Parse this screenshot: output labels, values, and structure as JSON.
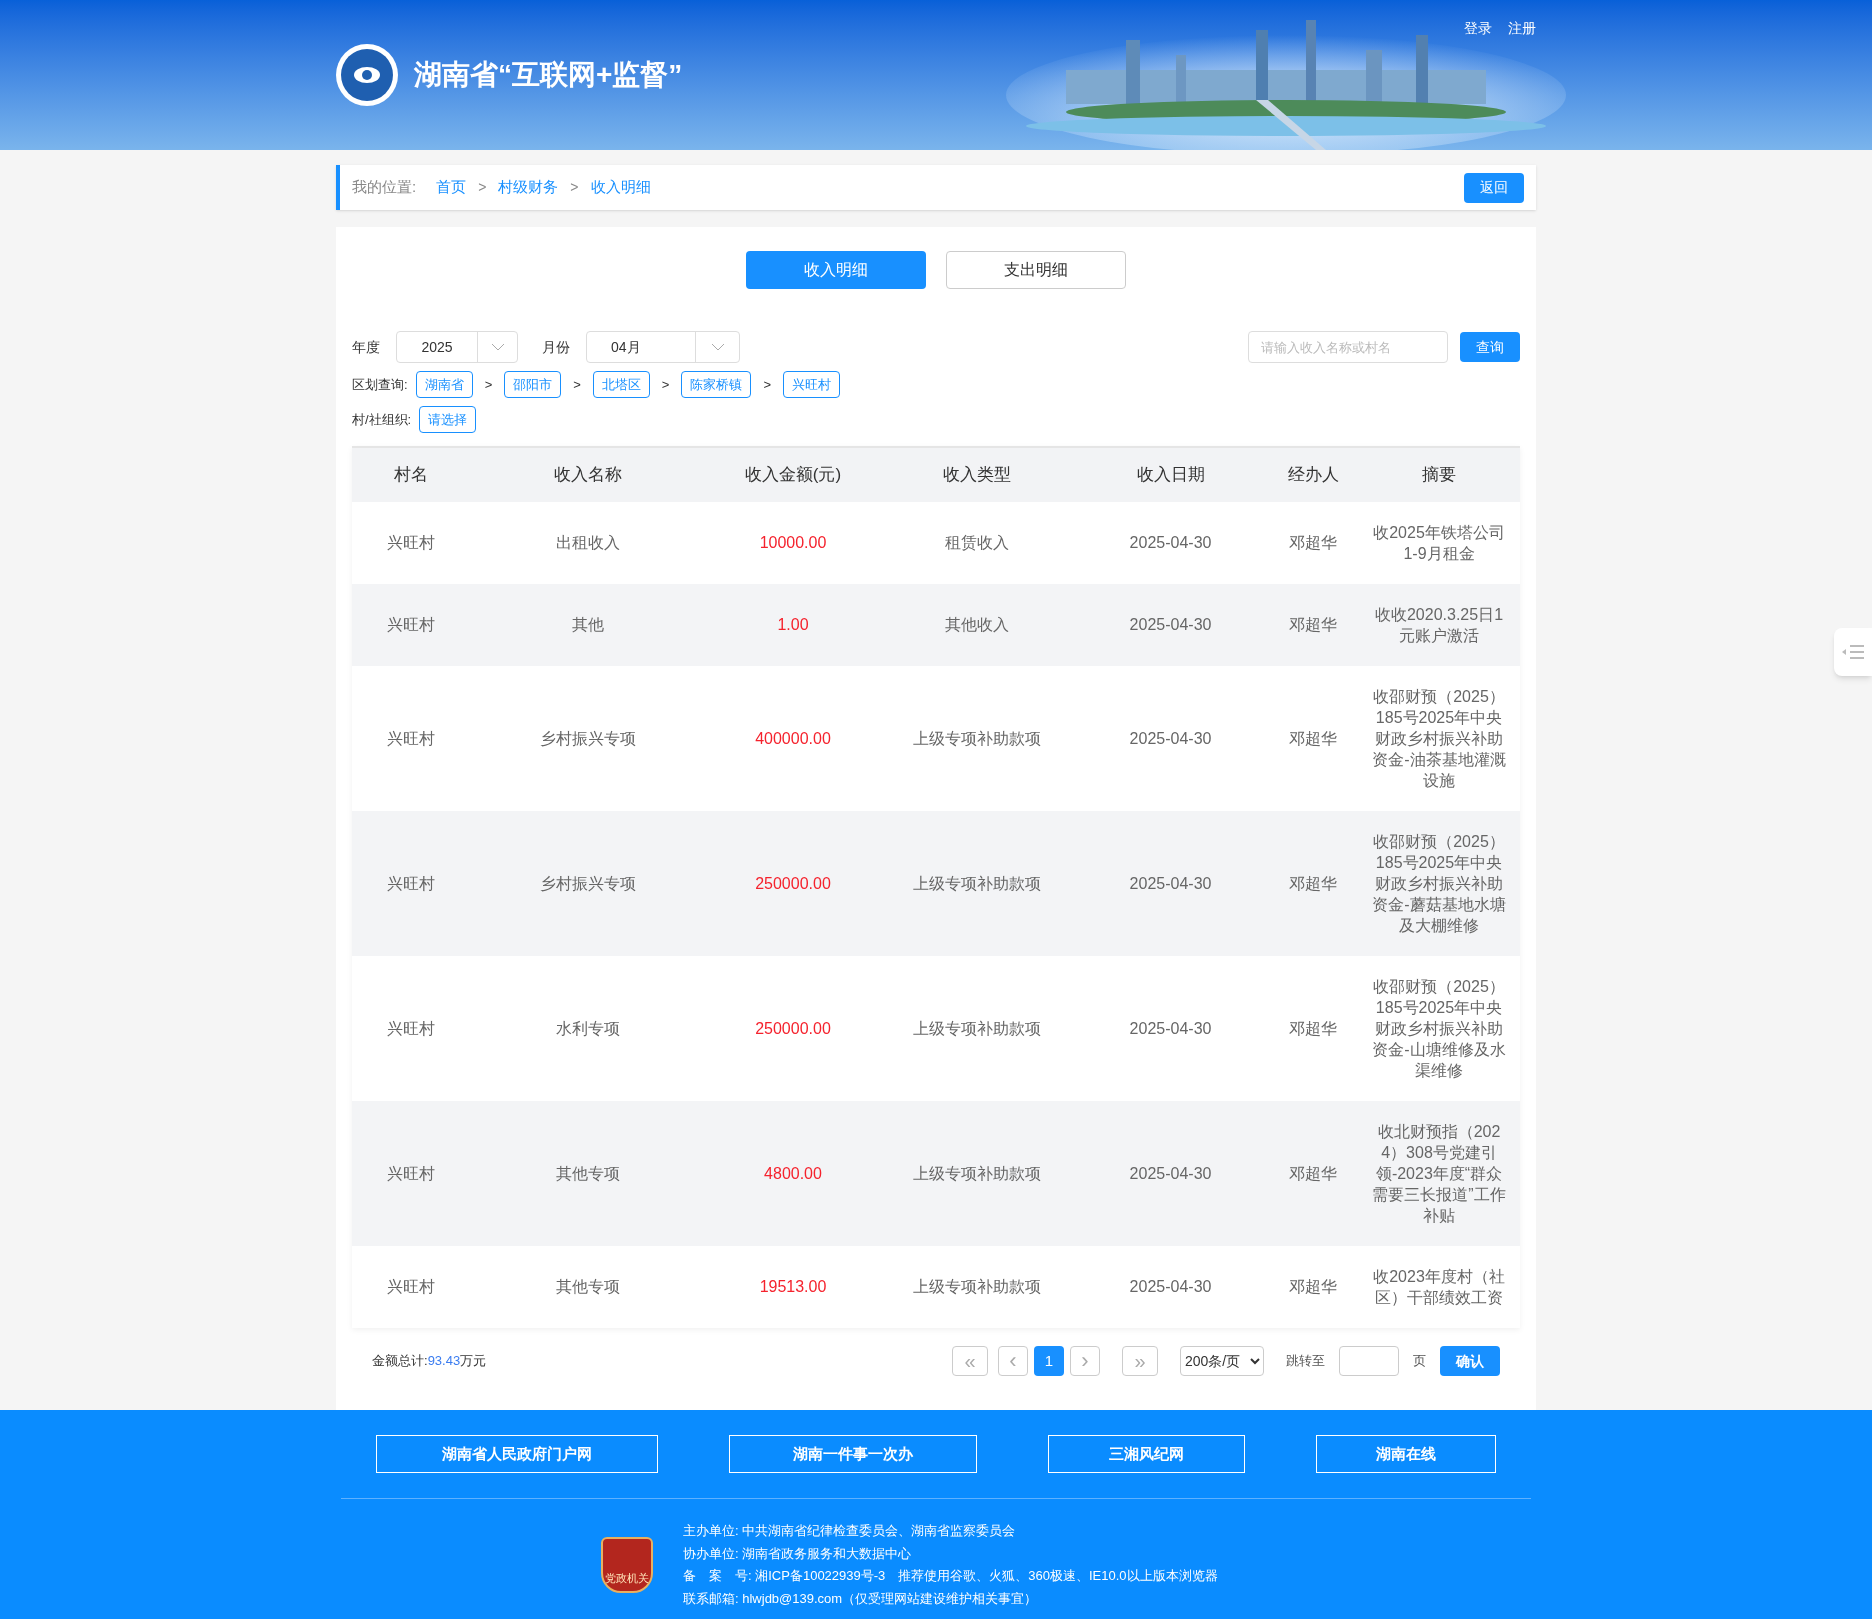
{
  "header": {
    "title": "湖南省“互联网+监督”",
    "links": [
      "登录",
      "注册"
    ]
  },
  "breadcrumb": {
    "label": "我的位置:",
    "items": [
      "首页",
      "村级财务",
      "收入明细"
    ],
    "separator": ">",
    "back": "返回"
  },
  "tabs": [
    {
      "label": "收入明细",
      "selected": true
    },
    {
      "label": "支出明细",
      "selected": false
    }
  ],
  "filters": {
    "year_label": "年度",
    "year": "2025",
    "month_label": "月份",
    "month": "04月",
    "search": {
      "placeholder": "请输入收入名称或村名"
    },
    "query": "查询",
    "region_label": "区划查询:",
    "regions": [
      "湖南省",
      "邵阳市",
      "北塔区",
      "陈家桥镇",
      "兴旺村"
    ],
    "region_separator": ">",
    "org_label": "村/社组织:",
    "org": "请选择"
  },
  "table": {
    "columns": [
      "村名",
      "收入名称",
      "收入金额(元)",
      "收入类型",
      "收入日期",
      "经办人",
      "摘要"
    ],
    "rows": [
      [
        "兴旺村",
        "出租收入",
        "10000.00",
        "租赁收入",
        "2025-04-30",
        "邓超华",
        "收2025年铁塔公司1-9月租金"
      ],
      [
        "兴旺村",
        "其他",
        "1.00",
        "其他收入",
        "2025-04-30",
        "邓超华",
        "收收2020.3.25日1元账户激活"
      ],
      [
        "兴旺村",
        "乡村振兴专项",
        "400000.00",
        "上级专项补助款项",
        "2025-04-30",
        "邓超华",
        "收邵财预（2025）185号2025年中央财政乡村振兴补助资金-油茶基地灌溉设施"
      ],
      [
        "兴旺村",
        "乡村振兴专项",
        "250000.00",
        "上级专项补助款项",
        "2025-04-30",
        "邓超华",
        "收邵财预（2025）185号2025年中央财政乡村振兴补助资金-蘑菇基地水塘及大棚维修"
      ],
      [
        "兴旺村",
        "水利专项",
        "250000.00",
        "上级专项补助款项",
        "2025-04-30",
        "邓超华",
        "收邵财预（2025）185号2025年中央财政乡村振兴补助资金-山塘维修及水渠维修"
      ],
      [
        "兴旺村",
        "其他专项",
        "4800.00",
        "上级专项补助款项",
        "2025-04-30",
        "邓超华",
        "收北财预指（2024）308号党建引领-2023年度“群众需要三长报道”工作补贴"
      ],
      [
        "兴旺村",
        "其他专项",
        "19513.00",
        "上级专项补助款项",
        "2025-04-30",
        "邓超华",
        "收2023年度村（社区）干部绩效工资"
      ]
    ]
  },
  "summary": {
    "label": "金额总计:",
    "value": "93.43",
    "unit": "万元"
  },
  "pagination": {
    "first": "«",
    "prev": "‹",
    "pages": [
      {
        "label": "1",
        "selected": true
      }
    ],
    "next": "›",
    "last": "»",
    "page_size": "200条/页",
    "jump_label": "跳转至",
    "page_unit": "页",
    "confirm": "确认"
  },
  "footer": {
    "links": [
      "湖南省人民政府门户网",
      "湖南一件事一次办",
      "三湘风纪网",
      "湖南在线"
    ],
    "badge": "党政机关",
    "lines": [
      {
        "label": "主办单位:",
        "text": "中共湖南省纪律检查委员会、湖南省监察委员会"
      },
      {
        "label": "协办单位:",
        "text": "湖南省政务服务和大数据中心"
      },
      {
        "label": "备　案　号:",
        "text": "湘ICP备10022939号-3　推荐使用谷歌、火狐、360极速、IE10.0以上版本浏览器"
      },
      {
        "label": "联系邮箱:",
        "text": "hlwjdb@139.com（仅受理网站建设维护相关事宜）"
      }
    ]
  }
}
